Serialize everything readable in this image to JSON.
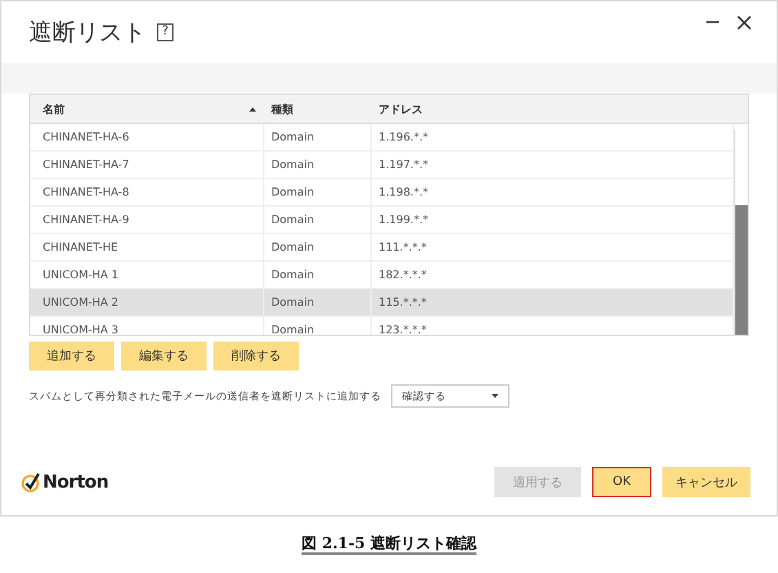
{
  "window": {
    "title": "遮断リスト",
    "help": "?"
  },
  "table": {
    "columns": [
      {
        "label": "名前",
        "sorted": true
      },
      {
        "label": "種類",
        "sorted": false
      },
      {
        "label": "アドレス",
        "sorted": false
      }
    ],
    "rows": [
      {
        "name": "CHINANET-HA-6",
        "type": "Domain",
        "address": "1.196.*.*",
        "selected": false
      },
      {
        "name": "CHINANET-HA-7",
        "type": "Domain",
        "address": "1.197.*.*",
        "selected": false
      },
      {
        "name": "CHINANET-HA-8",
        "type": "Domain",
        "address": "1.198.*.*",
        "selected": false
      },
      {
        "name": "CHINANET-HA-9",
        "type": "Domain",
        "address": "1.199.*.*",
        "selected": false
      },
      {
        "name": "CHINANET-HE",
        "type": "Domain",
        "address": "111.*.*.*",
        "selected": false
      },
      {
        "name": "UNICOM-HA 1",
        "type": "Domain",
        "address": "182.*.*.*",
        "selected": false
      },
      {
        "name": "UNICOM-HA 2",
        "type": "Domain",
        "address": "115.*.*.*",
        "selected": true
      },
      {
        "name": "UNICOM-HA 3",
        "type": "Domain",
        "address": "123.*.*.*",
        "selected": false
      }
    ]
  },
  "list_buttons": [
    "追加する",
    "編集する",
    "削除する"
  ],
  "option": {
    "label": "スパムとして再分類された電子メールの送信者を遮断リストに追加する",
    "value": "確認する"
  },
  "logo": "Norton",
  "footer_buttons": [
    {
      "label": "適用する",
      "disabled": true,
      "focused": false
    },
    {
      "label": "OK",
      "disabled": false,
      "focused": true
    },
    {
      "label": "キャンセル",
      "disabled": false,
      "focused": false
    }
  ],
  "caption": "図 2.1-5 遮断リスト確認"
}
